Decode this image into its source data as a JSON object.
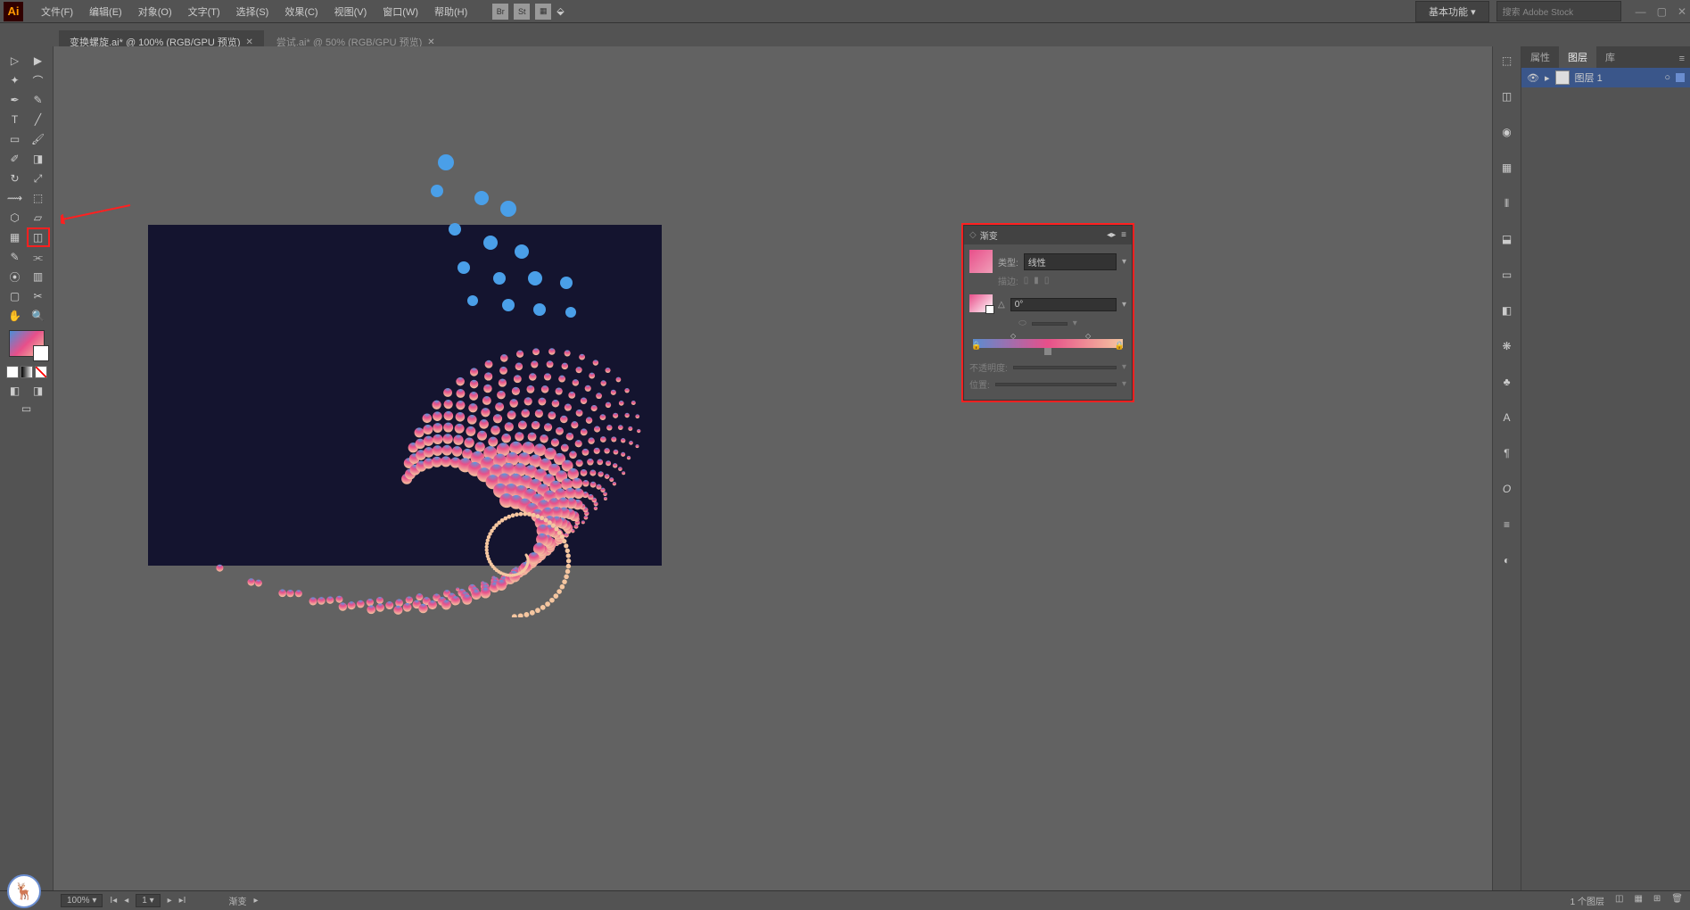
{
  "app": {
    "logo": "Ai"
  },
  "menu": {
    "items": [
      "文件(F)",
      "编辑(E)",
      "对象(O)",
      "文字(T)",
      "选择(S)",
      "效果(C)",
      "视图(V)",
      "窗口(W)",
      "帮助(H)"
    ]
  },
  "top_icons": [
    "Br",
    "St",
    "lib",
    "col"
  ],
  "workspace": {
    "label": "基本功能 ▾"
  },
  "search": {
    "placeholder": "搜索 Adobe Stock"
  },
  "tabs": [
    {
      "label": "变换螺旋.ai* @ 100% (RGB/GPU 预览)",
      "active": true
    },
    {
      "label": "尝试.ai* @ 50% (RGB/GPU 预览)",
      "active": false
    }
  ],
  "tools_left": [
    [
      "selection",
      "direct-select"
    ],
    [
      "magic-wand",
      "lasso"
    ],
    [
      "pen",
      "curvature"
    ],
    [
      "type",
      "line"
    ],
    [
      "rectangle",
      "paintbrush"
    ],
    [
      "shaper",
      "eraser"
    ],
    [
      "rotate",
      "scale"
    ],
    [
      "width",
      "free-transform"
    ],
    [
      "shape-builder",
      "perspective"
    ],
    [
      "mesh",
      "gradient"
    ],
    [
      "eyedropper",
      "blend"
    ],
    [
      "symbol-spray",
      "column-graph"
    ],
    [
      "artboard",
      "slice"
    ],
    [
      "hand",
      "zoom"
    ]
  ],
  "swatch_modes": [
    "solid",
    "gradient",
    "none"
  ],
  "gradient_panel": {
    "title": "渐变",
    "type_label": "类型:",
    "type_value": "线性",
    "stroke_label": "描边:",
    "angle_label": "△",
    "angle_value": "0°",
    "opacity_label": "不透明度:",
    "location_label": "位置:"
  },
  "layers_panel": {
    "tabs": [
      "属性",
      "图层",
      "库"
    ],
    "active_tab": 1,
    "layer_name": "图层 1"
  },
  "right_dock_icons": [
    "artboard",
    "assets",
    "appearance",
    "align",
    "transform",
    "pathfinder",
    "color",
    "swatches",
    "type-a",
    "paragraph",
    "opentype",
    "stroke",
    "more"
  ],
  "arrow": {
    "semantic": "arrow pointing to gradient tool in toolbox"
  },
  "status": {
    "zoom": "100%",
    "page": "1",
    "tool": "渐变",
    "right": "1 个图层"
  }
}
